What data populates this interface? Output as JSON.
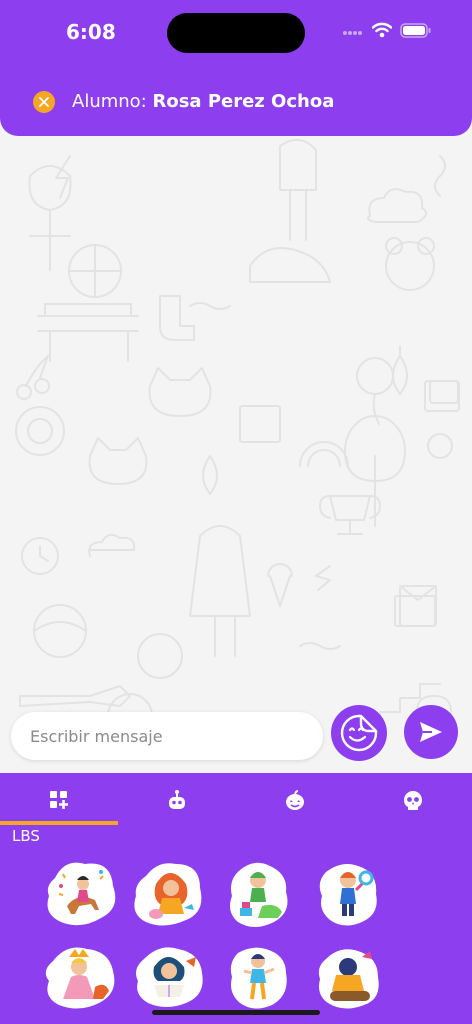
{
  "status_bar": {
    "time": "6:08"
  },
  "header": {
    "prefix": "Alumno: ",
    "student_name": "Rosa Perez Ochoa"
  },
  "composer": {
    "placeholder": "Escribir mensaje"
  },
  "sticker_panel": {
    "tabs": [
      {
        "icon": "sticker-grid-icon",
        "selected": true
      },
      {
        "icon": "robot-icon",
        "selected": false
      },
      {
        "icon": "pumpkin-icon",
        "selected": false
      },
      {
        "icon": "skull-icon",
        "selected": false
      }
    ],
    "pack_name": "LBS",
    "stickers": [
      "girl-on-horse-sticker",
      "girl-with-piggy-sticker",
      "boy-with-dinosaur-sticker",
      "boy-with-magnifier-sticker",
      "princess-with-dragon-sticker",
      "girl-reading-book-sticker",
      "boy-jumping-sticker",
      "boy-reading-log-sticker"
    ]
  },
  "colors": {
    "brand": "#8d3ff0",
    "accent": "#f5a623",
    "background": "#f4f4f4"
  }
}
